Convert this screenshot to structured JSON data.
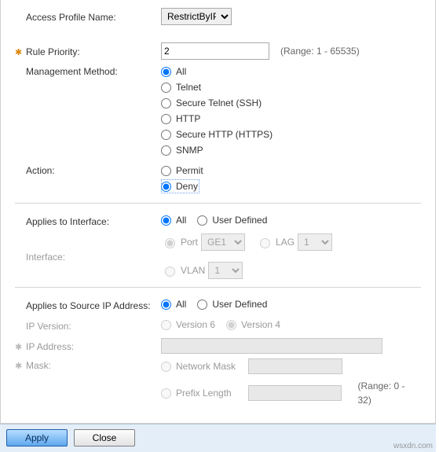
{
  "profile": {
    "label": "Access Profile Name:",
    "value": "RestrictByIP"
  },
  "priority": {
    "label": "Rule Priority:",
    "value": "2",
    "hint": "(Range: 1 - 65535)"
  },
  "mgmt": {
    "label": "Management Method:",
    "options": {
      "all": "All",
      "telnet": "Telnet",
      "ssh": "Secure Telnet (SSH)",
      "http": "HTTP",
      "https": "Secure HTTP (HTTPS)",
      "snmp": "SNMP"
    }
  },
  "action": {
    "label": "Action:",
    "permit": "Permit",
    "deny": "Deny"
  },
  "iface": {
    "applies_label": "Applies to Interface:",
    "all": "All",
    "user_defined": "User Defined",
    "label": "Interface:",
    "port": "Port",
    "port_val": "GE1",
    "lag": "LAG",
    "lag_val": "1",
    "vlan": "VLAN",
    "vlan_val": "1"
  },
  "srcip": {
    "applies_label": "Applies to Source IP Address:",
    "all": "All",
    "user_defined": "User Defined",
    "ipver_label": "IP Version:",
    "v6": "Version 6",
    "v4": "Version 4",
    "ip_label": "IP Address:",
    "mask_label": "Mask:",
    "nm": "Network Mask",
    "pl": "Prefix Length",
    "hint": "(Range: 0 - 32)"
  },
  "buttons": {
    "apply": "Apply",
    "close": "Close"
  },
  "credit": "wsxdn.com"
}
